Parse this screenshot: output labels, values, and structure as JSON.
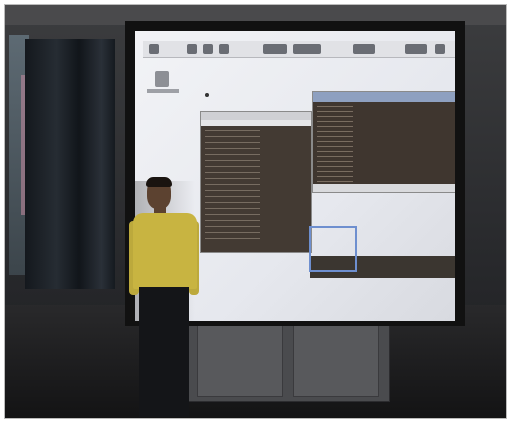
{
  "scene": {
    "description_icons": [
      "projector-screen-icon",
      "person-icon"
    ],
    "colors": {
      "wall": "#2a2b2e",
      "screen": "#eceef2",
      "terminal": "#433a33",
      "shirt": "#c8b441",
      "selection": "#6e8fcf"
    }
  }
}
